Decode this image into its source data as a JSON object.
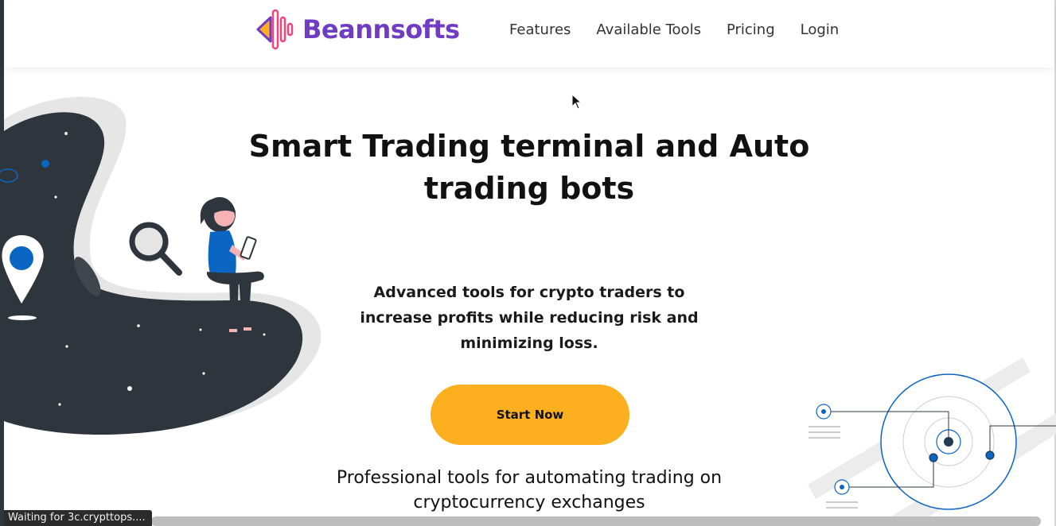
{
  "brand": {
    "name": "Beannsofts",
    "accent_color": "#6f3cc3",
    "logo_icon": "sound-wave-logo-icon"
  },
  "nav": {
    "items": [
      {
        "label": "Features"
      },
      {
        "label": "Available Tools"
      },
      {
        "label": "Pricing"
      },
      {
        "label": "Login"
      }
    ]
  },
  "hero": {
    "title_line1": "Smart Trading terminal and Auto",
    "title_line2": "trading bots",
    "subtitle": "Advanced tools for crypto traders to increase profits while reducing risk and minimizing loss.",
    "cta_label": "Start Now",
    "cta_color": "#fdb01f",
    "footer_line1": "Professional tools for automating trading on",
    "footer_line2": "cryptocurrency exchanges"
  },
  "illustrations": {
    "left": "woman-reading-phone-on-planet-illustration",
    "right": "radar-network-illustration",
    "dark_color": "#2f353c",
    "blue_color": "#0a66c2"
  },
  "status": {
    "text": "Waiting for 3c.crypttops...."
  }
}
